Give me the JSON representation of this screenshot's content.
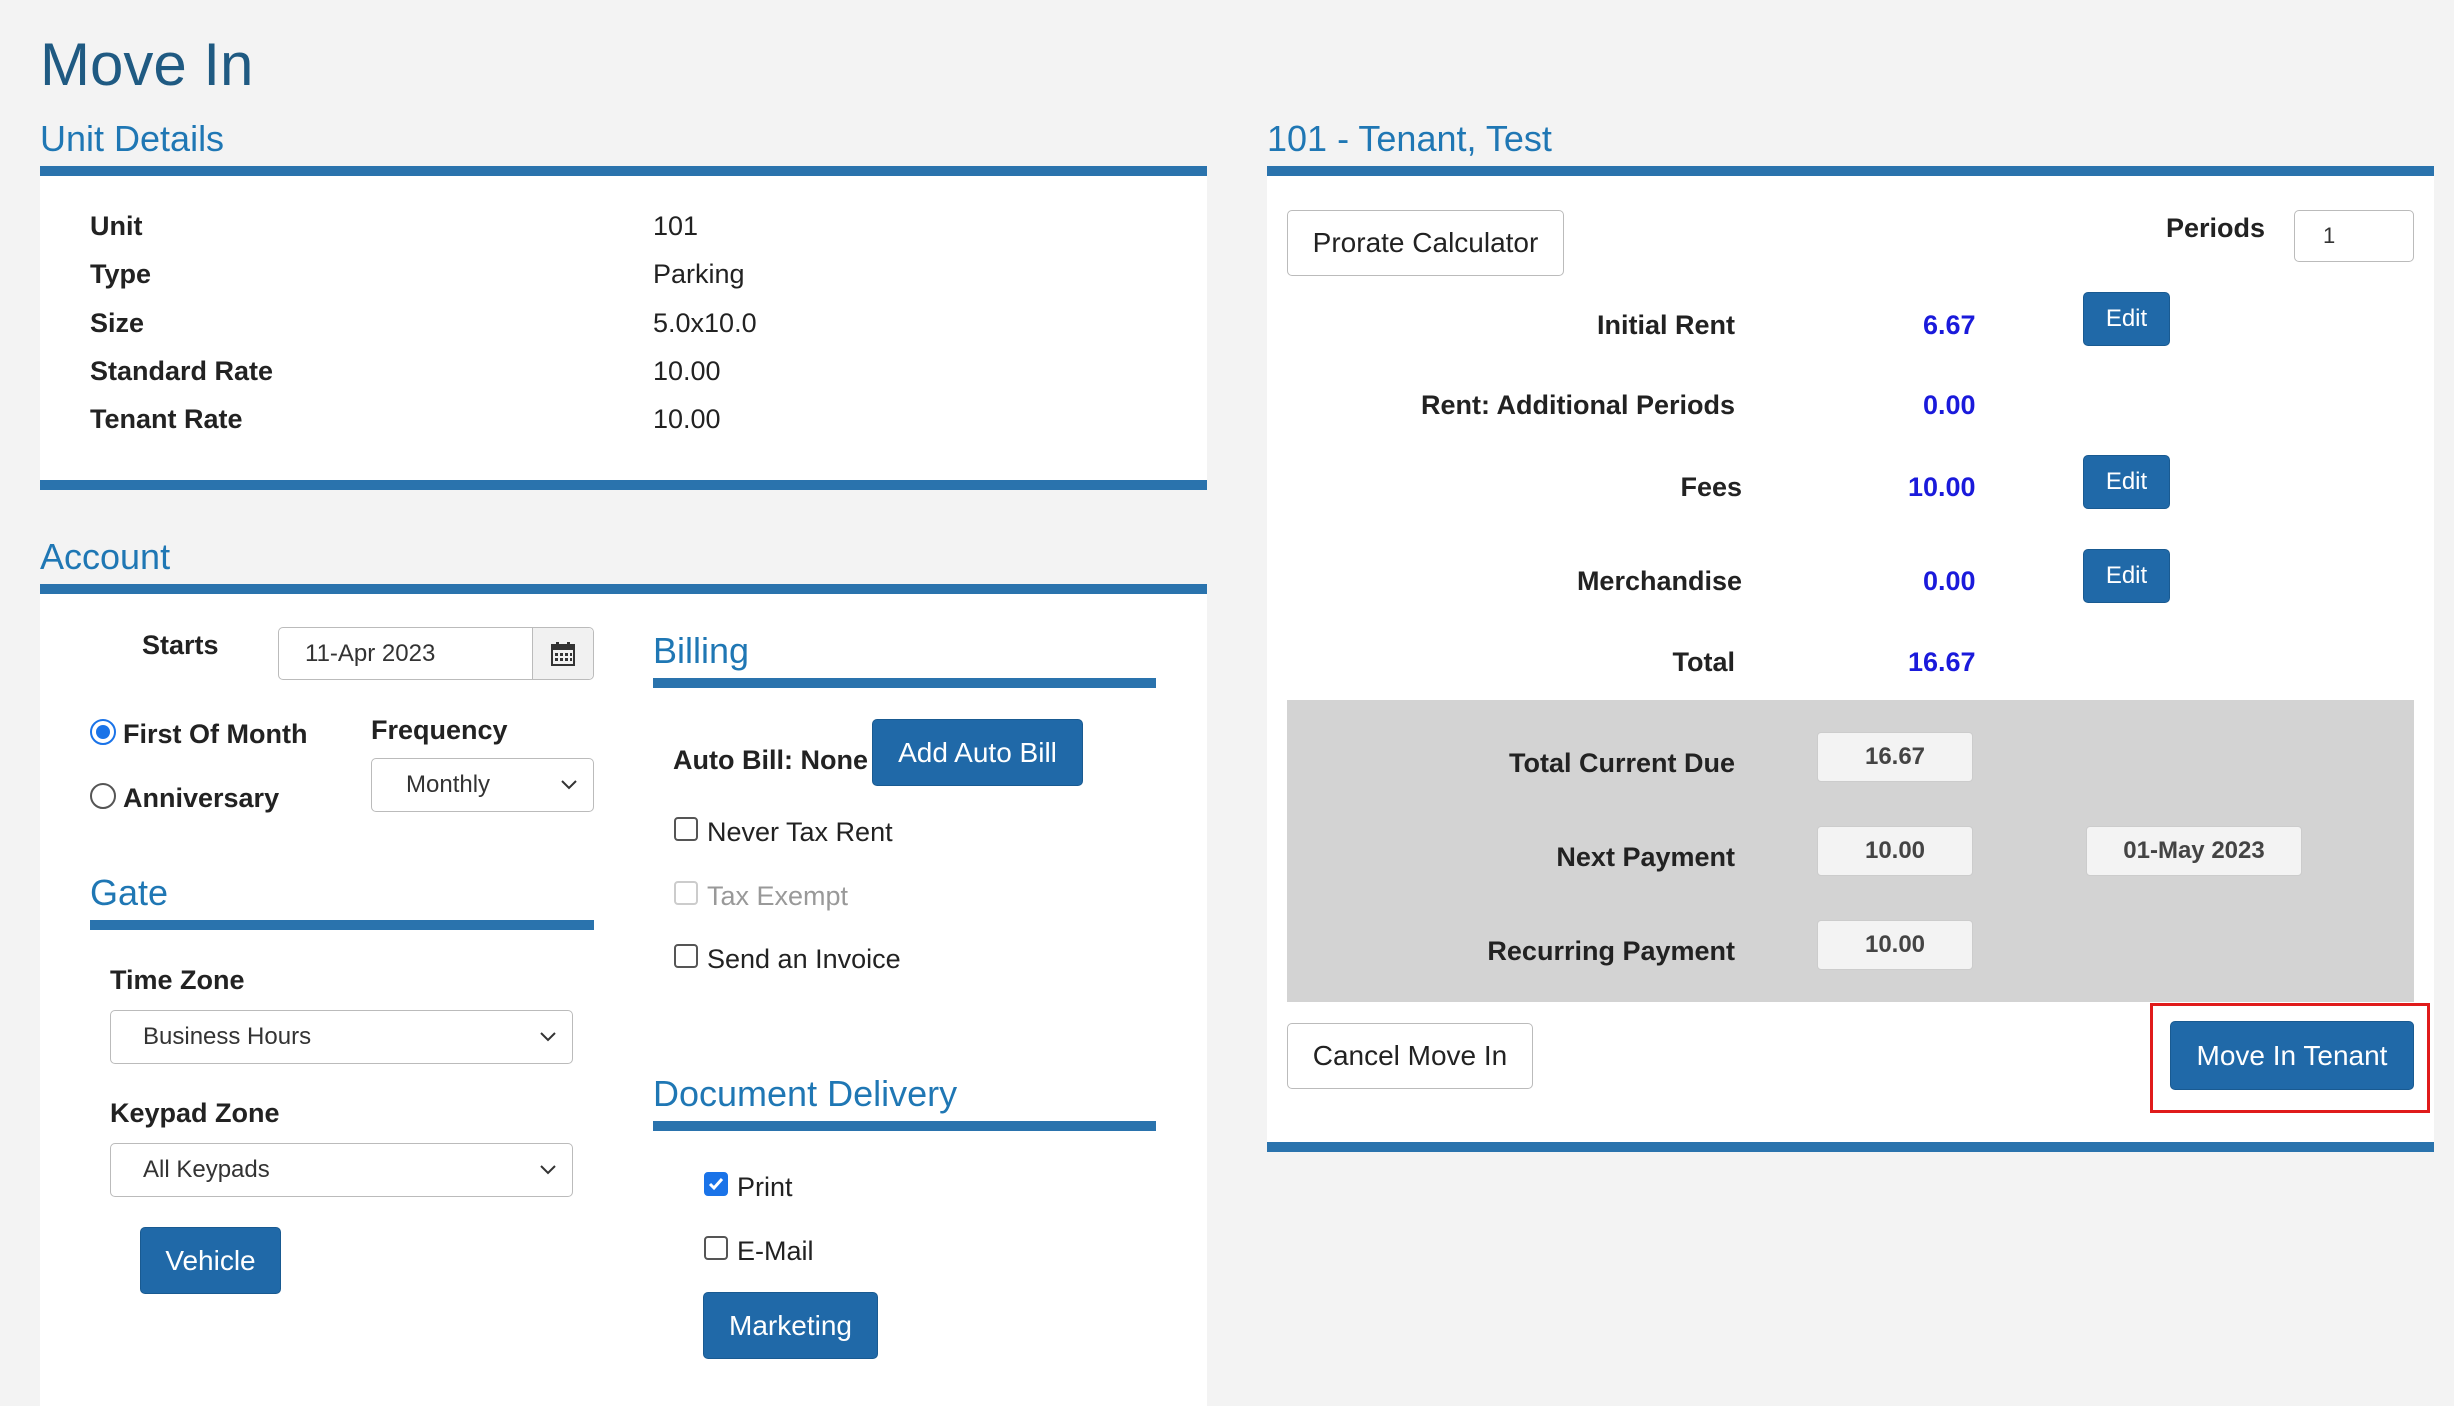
{
  "page": {
    "title": "Move In"
  },
  "unit_details": {
    "title": "Unit Details",
    "rows": [
      {
        "label": "Unit",
        "value": "101"
      },
      {
        "label": "Type",
        "value": "Parking"
      },
      {
        "label": "Size",
        "value": "5.0x10.0"
      },
      {
        "label": "Standard Rate",
        "value": "10.00"
      },
      {
        "label": "Tenant Rate",
        "value": "10.00"
      }
    ]
  },
  "account": {
    "title": "Account",
    "starts_label": "Starts",
    "starts_value": "11-Apr 2023",
    "first_of_month_label": "First Of Month",
    "anniversary_label": "Anniversary",
    "frequency_label": "Frequency",
    "frequency_value": "Monthly"
  },
  "gate": {
    "title": "Gate",
    "time_zone_label": "Time Zone",
    "time_zone_value": "Business Hours",
    "keypad_zone_label": "Keypad Zone",
    "keypad_zone_value": "All Keypads",
    "vehicle_button": "Vehicle"
  },
  "billing": {
    "title": "Billing",
    "auto_bill_label": "Auto Bill: None",
    "add_auto_bill_button": "Add Auto Bill",
    "never_tax_rent": "Never Tax Rent",
    "tax_exempt": "Tax Exempt",
    "send_invoice": "Send an Invoice"
  },
  "document_delivery": {
    "title": "Document Delivery",
    "print": "Print",
    "email": "E-Mail",
    "marketing_button": "Marketing"
  },
  "tenant": {
    "title": "101 - Tenant, Test",
    "prorate_button": "Prorate Calculator",
    "periods_label": "Periods",
    "periods_value": "1",
    "initial_rent_label": "Initial Rent",
    "initial_rent_value": "6.67",
    "additional_periods_label": "Rent: Additional Periods",
    "additional_periods_value": "0.00",
    "fees_label": "Fees",
    "fees_value": "10.00",
    "merchandise_label": "Merchandise",
    "merchandise_value": "0.00",
    "total_label": "Total",
    "total_value": "16.67",
    "edit_label": "Edit",
    "total_current_due_label": "Total Current Due",
    "total_current_due_value": "16.67",
    "next_payment_label": "Next Payment",
    "next_payment_value": "10.00",
    "next_payment_date": "01-May 2023",
    "recurring_payment_label": "Recurring Payment",
    "recurring_payment_value": "10.00",
    "cancel_button": "Cancel Move In",
    "move_in_button": "Move In Tenant"
  },
  "colors": {
    "accent": "#2069a8",
    "title": "#1f5a82",
    "amount": "#1a1adb",
    "highlight": "#e01b1b"
  }
}
